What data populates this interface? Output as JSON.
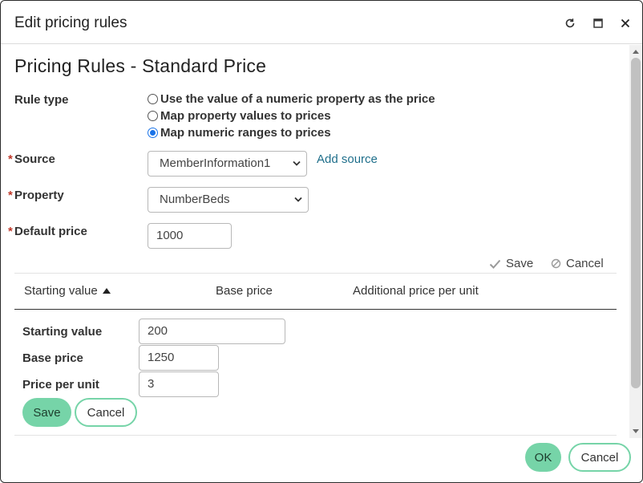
{
  "dialog": {
    "title": "Edit pricing rules",
    "icons": {
      "refresh": "refresh-icon",
      "maximize": "maximize-icon",
      "close": "close-icon"
    }
  },
  "form": {
    "heading": "Pricing Rules - Standard Price",
    "rule_type": {
      "label": "Rule type",
      "options": [
        {
          "label": "Use the value of a numeric property as the price",
          "checked": false
        },
        {
          "label": "Map property values to prices",
          "checked": false
        },
        {
          "label": "Map numeric ranges to prices",
          "checked": true
        }
      ]
    },
    "source": {
      "label": "Source",
      "required": "*",
      "value": "MemberInformation1",
      "add_link": "Add source"
    },
    "property": {
      "label": "Property",
      "required": "*",
      "value": "NumberBeds"
    },
    "default_price": {
      "label": "Default price",
      "required": "*",
      "value": "1000"
    }
  },
  "grid": {
    "save_label": "Save",
    "cancel_label": "Cancel",
    "columns": [
      "Starting value",
      "Base price",
      "Additional price per unit"
    ],
    "sort_column": "Starting value",
    "edit_row": {
      "starting_value": {
        "label": "Starting value",
        "value": "200"
      },
      "base_price": {
        "label": "Base price",
        "value": "1250"
      },
      "price_per_unit": {
        "label": "Price per unit",
        "value": "3"
      },
      "save_label": "Save",
      "cancel_label": "Cancel"
    }
  },
  "footer": {
    "ok_label": "OK",
    "cancel_label": "Cancel"
  },
  "colors": {
    "accent": "#76d4a8",
    "link": "#1f6f8b",
    "required": "#c0392b",
    "radio": "#1a73e8"
  }
}
